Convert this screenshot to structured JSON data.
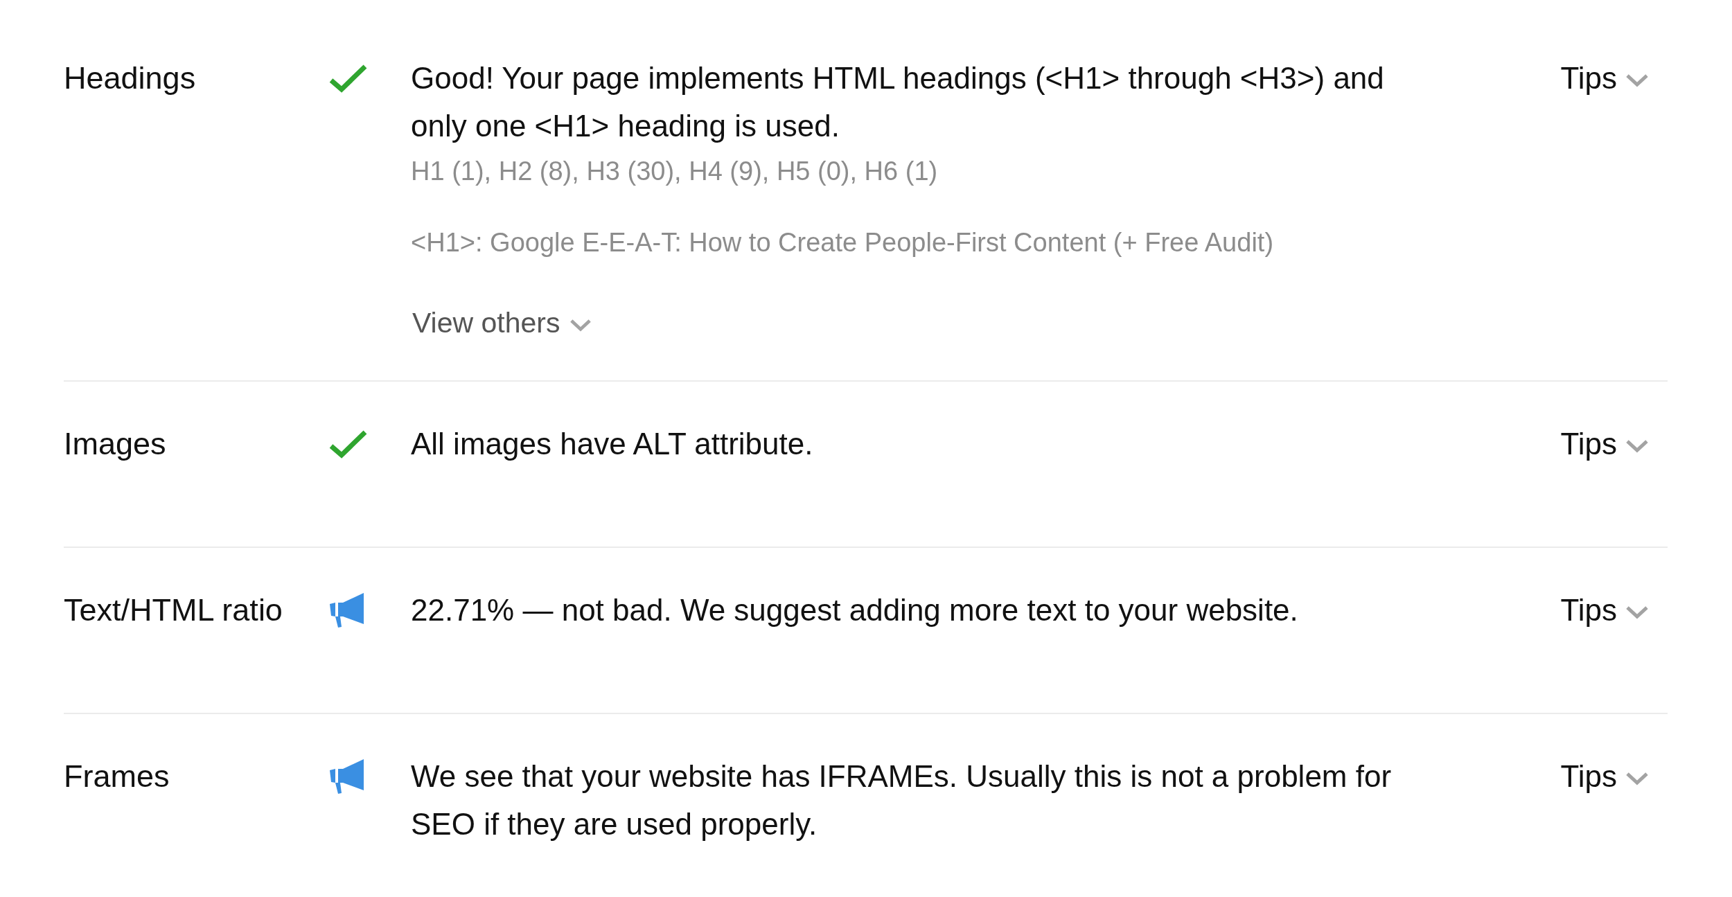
{
  "rows": [
    {
      "label": "Headings",
      "kind": "passed",
      "message": "Good! Your page implements HTML headings (<H1> through <H3>) and only one <H1> heading is used.",
      "counts": "H1 (1), H2 (8), H3 (30), H4 (9), H5 (0), H6 (1)",
      "h1_text": "<H1>: Google E-E-A-T: How to Create People-First Content (+ Free Audit)",
      "view_others": "View others",
      "tips": "Tips"
    },
    {
      "label": "Images",
      "kind": "passed",
      "message": "All images have ALT attribute.",
      "tips": "Tips"
    },
    {
      "label": "Text/HTML ratio",
      "kind": "notice",
      "message": "22.71% — not bad. We suggest adding more text to your website.",
      "tips": "Tips"
    },
    {
      "label": "Frames",
      "kind": "notice",
      "message": "We see that your website has IFRAMEs. Usually this is not a problem for SEO if they are used properly.",
      "tips": "Tips"
    }
  ]
}
